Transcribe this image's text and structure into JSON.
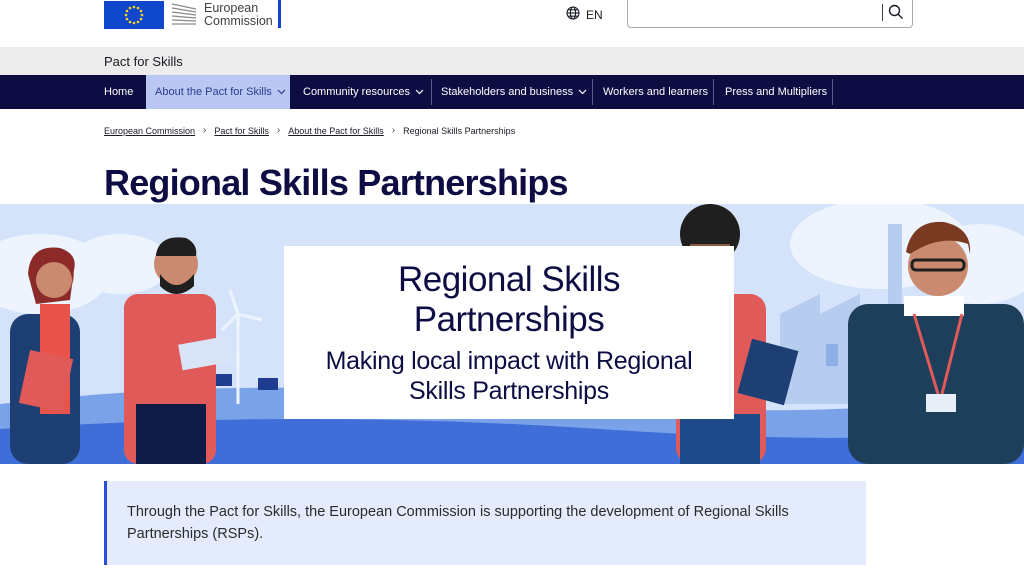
{
  "header": {
    "logo_line1": "European",
    "logo_line2": "Commission",
    "language": "EN",
    "search_placeholder": ""
  },
  "site": {
    "name": "Pact for Skills"
  },
  "nav": {
    "items": [
      {
        "label": "Home"
      },
      {
        "label": "About the Pact for Skills"
      },
      {
        "label": "Community resources"
      },
      {
        "label": "Stakeholders and business"
      },
      {
        "label": "Workers and learners"
      },
      {
        "label": "Press and Multipliers"
      }
    ]
  },
  "breadcrumb": {
    "items": [
      {
        "label": "European Commission"
      },
      {
        "label": "Pact for Skills"
      },
      {
        "label": "About the Pact for Skills"
      },
      {
        "label": "Regional Skills Partnerships"
      }
    ]
  },
  "page": {
    "title": "Regional Skills Partnerships"
  },
  "hero": {
    "title_line1": "Regional Skills",
    "title_line2": "Partnerships",
    "subtitle_line1": "Making local impact with Regional",
    "subtitle_line2": "Skills Partnerships"
  },
  "intro": {
    "text": "Through the Pact for Skills, the European Commission is supporting the development of Regional Skills Partnerships (RSPs)."
  },
  "colors": {
    "nav_background": "#0d0d44",
    "nav_active": "#b9c7f2",
    "brand_blue": "#0e47cb",
    "intro_background": "#e4ebfc",
    "intro_border": "#2a4fd7"
  },
  "icons": {
    "language": "globe-icon",
    "search": "search-icon",
    "nav_dropdown": "chevron-down-icon",
    "breadcrumb_separator": "chevron-right-icon"
  }
}
